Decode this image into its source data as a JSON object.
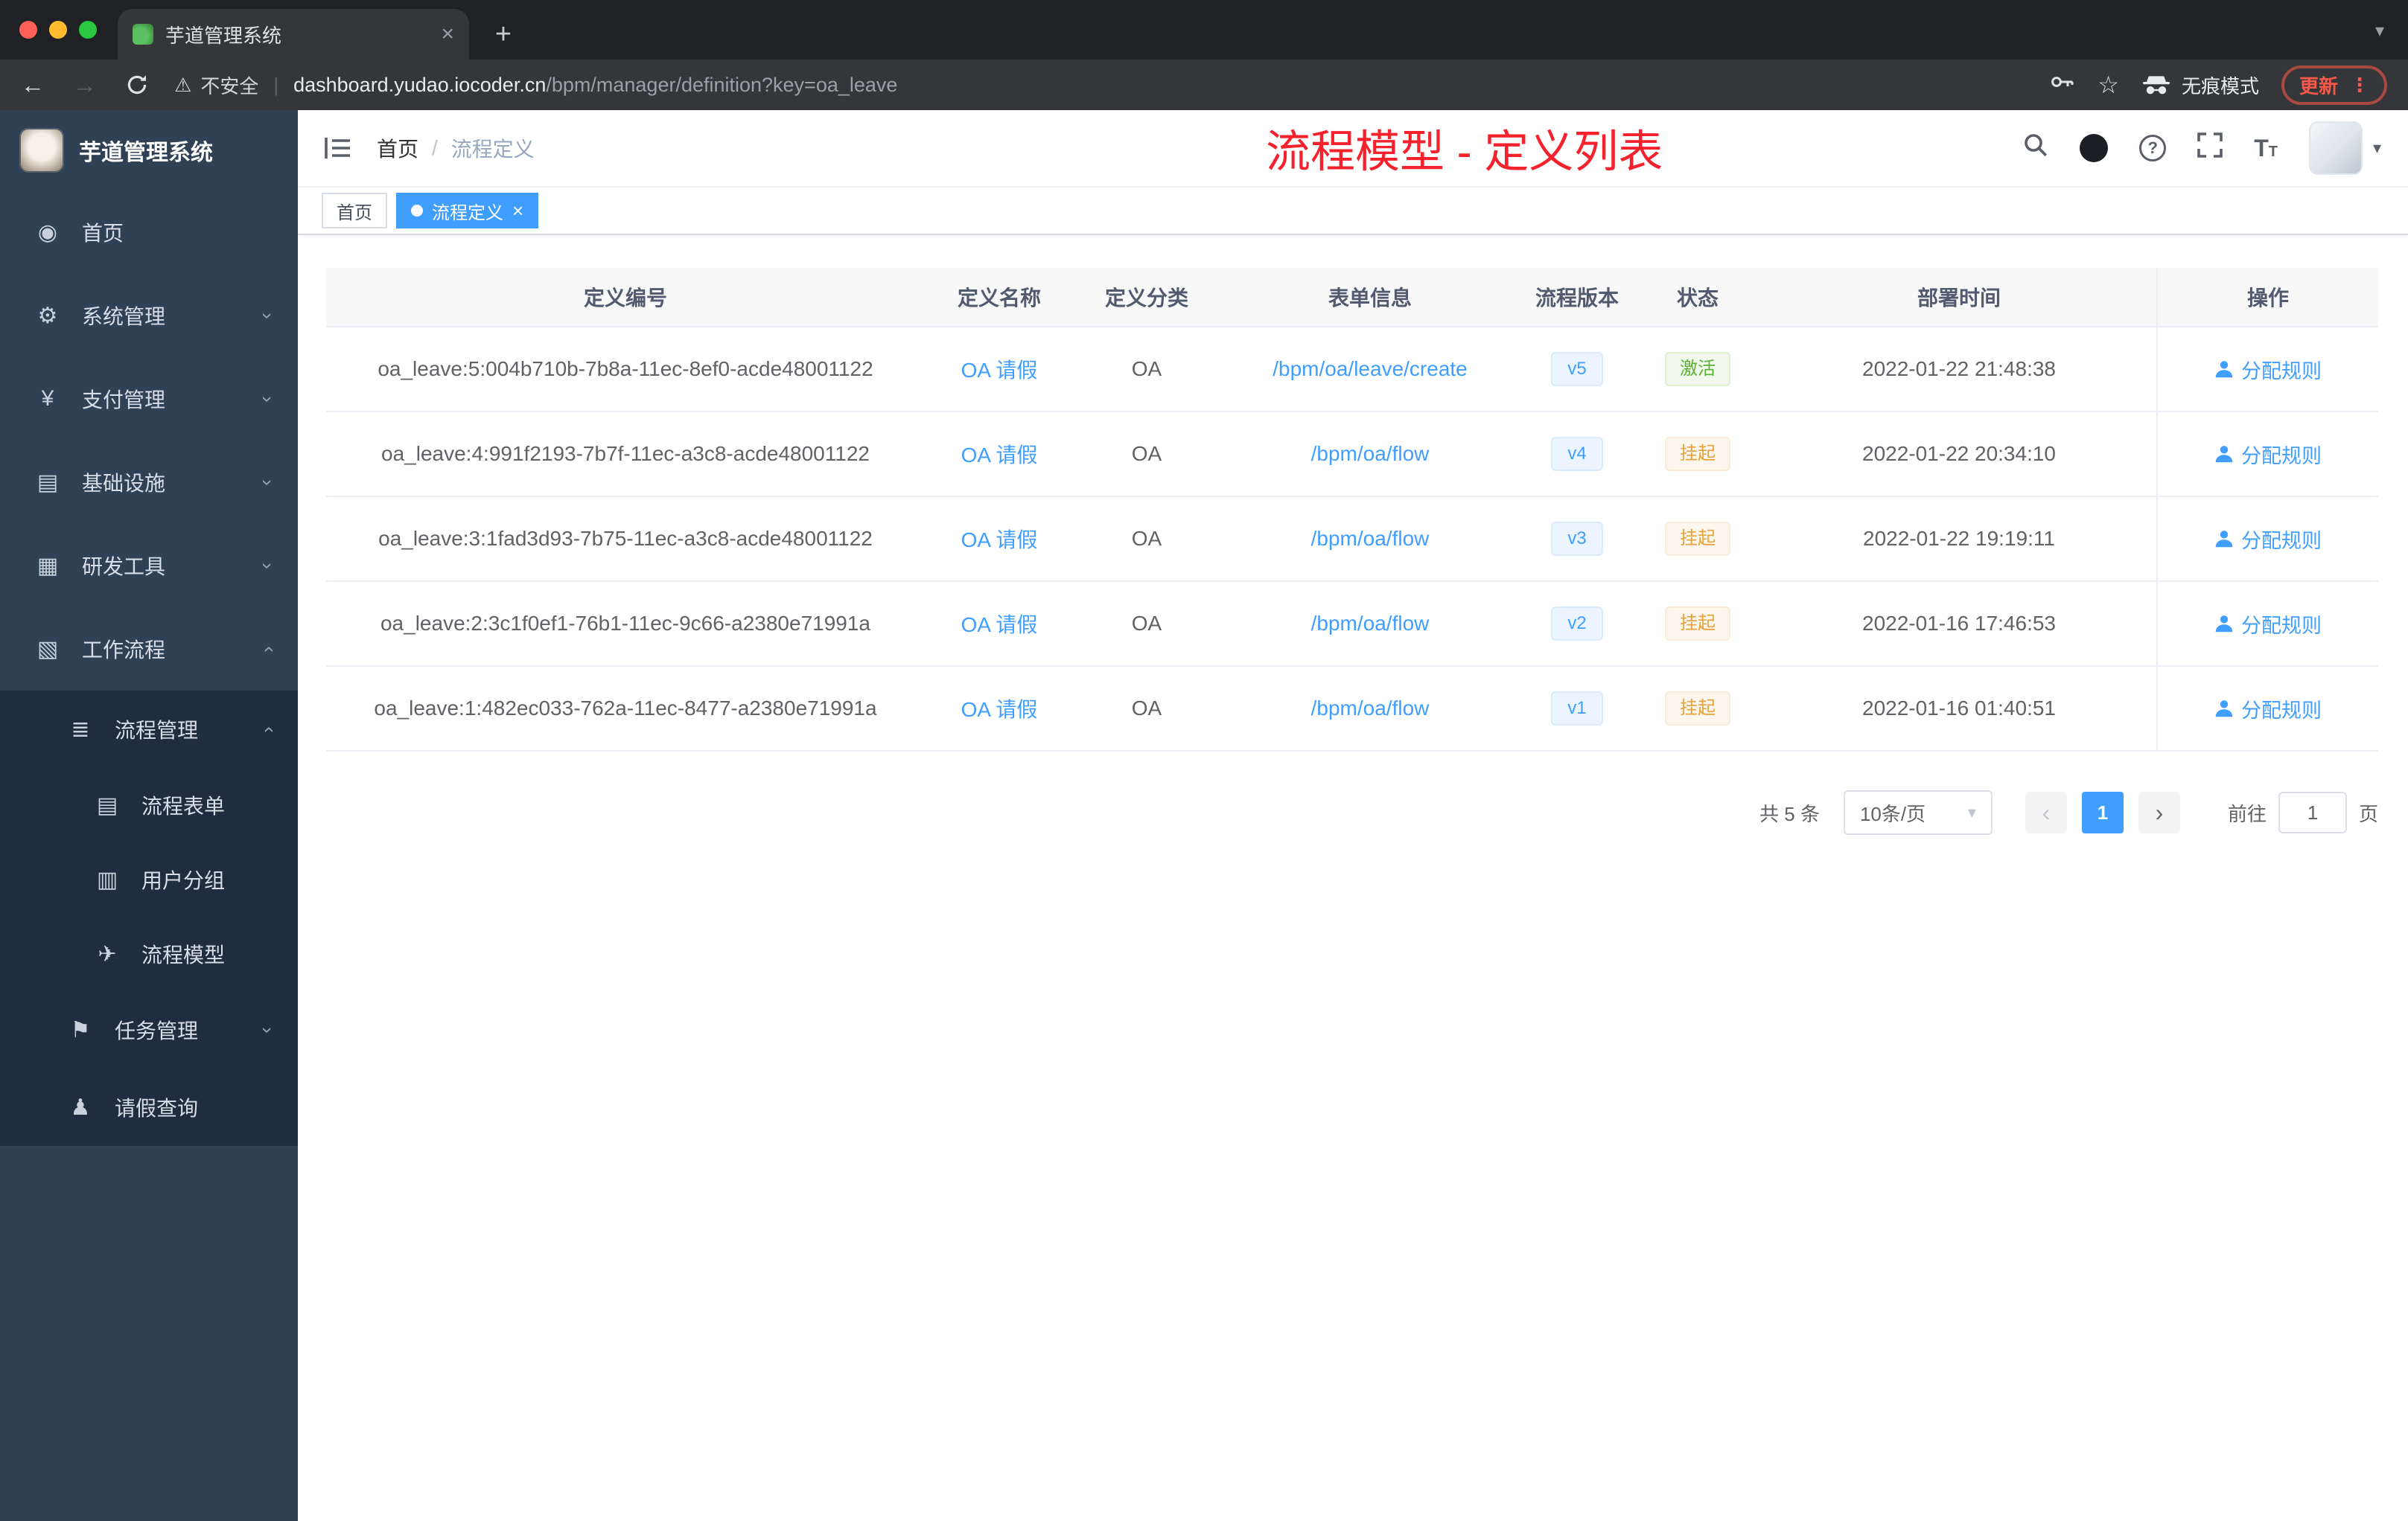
{
  "browser": {
    "tab_title": "芋道管理系统",
    "not_secure_label": "不安全",
    "url_domain": "dashboard.yudao.iocoder.cn",
    "url_path": "/bpm/manager/definition?key=oa_leave",
    "incognito_label": "无痕模式",
    "update_label": "更新"
  },
  "glyphs": {
    "back": "←",
    "forward": "→",
    "warning": "⚠",
    "pipe": "|",
    "star": "☆",
    "dots": "⋮",
    "plus": "+",
    "close": "×",
    "caret_down": "▾",
    "chevron": "›",
    "prev": "‹",
    "next": "›",
    "question": "?",
    "font_size_big": "T",
    "font_size_small": "T"
  },
  "sidebar": {
    "logo_title": "芋道管理系统",
    "menu": [
      {
        "label": "首页",
        "glyph": "◉"
      },
      {
        "label": "系统管理",
        "glyph": "⚙"
      },
      {
        "label": "支付管理",
        "glyph": "¥"
      },
      {
        "label": "基础设施",
        "glyph": "▤"
      },
      {
        "label": "研发工具",
        "glyph": "▦"
      },
      {
        "label": "工作流程",
        "glyph": "▧"
      }
    ],
    "submenu": {
      "process_mgmt": {
        "label": "流程管理",
        "glyph": "≣"
      },
      "process_form": {
        "label": "流程表单",
        "glyph": "▤"
      },
      "user_group": {
        "label": "用户分组",
        "glyph": "▥"
      },
      "process_model": {
        "label": "流程模型",
        "glyph": "✈"
      },
      "task_mgmt": {
        "label": "任务管理",
        "glyph": "⚑"
      },
      "leave_query": {
        "label": "请假查询",
        "glyph": "♟"
      }
    }
  },
  "header": {
    "breadcrumb_home": "首页",
    "breadcrumb_separator": "/",
    "breadcrumb_current": "流程定义",
    "annotation": "流程模型 - 定义列表"
  },
  "tags_view": {
    "home": "首页",
    "active": "流程定义"
  },
  "table": {
    "columns": [
      "定义编号",
      "定义名称",
      "定义分类",
      "表单信息",
      "流程版本",
      "状态",
      "部署时间",
      "操作"
    ],
    "action_label": "分配规则",
    "rows": [
      {
        "id": "oa_leave:5:004b710b-7b8a-11ec-8ef0-acde48001122",
        "name": "OA 请假",
        "category": "OA",
        "form": "/bpm/oa/leave/create",
        "version": "v5",
        "status": "激活",
        "time": "2022-01-22 21:48:38"
      },
      {
        "id": "oa_leave:4:991f2193-7b7f-11ec-a3c8-acde48001122",
        "name": "OA 请假",
        "category": "OA",
        "form": "/bpm/oa/flow",
        "version": "v4",
        "status": "挂起",
        "time": "2022-01-22 20:34:10"
      },
      {
        "id": "oa_leave:3:1fad3d93-7b75-11ec-a3c8-acde48001122",
        "name": "OA 请假",
        "category": "OA",
        "form": "/bpm/oa/flow",
        "version": "v3",
        "status": "挂起",
        "time": "2022-01-22 19:19:11"
      },
      {
        "id": "oa_leave:2:3c1f0ef1-76b1-11ec-9c66-a2380e71991a",
        "name": "OA 请假",
        "category": "OA",
        "form": "/bpm/oa/flow",
        "version": "v2",
        "status": "挂起",
        "time": "2022-01-16 17:46:53"
      },
      {
        "id": "oa_leave:1:482ec033-762a-11ec-8477-a2380e71991a",
        "name": "OA 请假",
        "category": "OA",
        "form": "/bpm/oa/flow",
        "version": "v1",
        "status": "挂起",
        "time": "2022-01-16 01:40:51"
      }
    ]
  },
  "pagination": {
    "total": "共 5 条",
    "page_size": "10条/页",
    "page": "1",
    "goto_label": "前往",
    "goto_value": "1",
    "goto_suffix": "页"
  },
  "colors": {
    "primary": "#409eff",
    "success": "#67c23a",
    "warning": "#e6a23c",
    "annotation": "#f5222d",
    "sidebar_bg": "#304156",
    "submenu_bg": "#1f2d3e"
  }
}
